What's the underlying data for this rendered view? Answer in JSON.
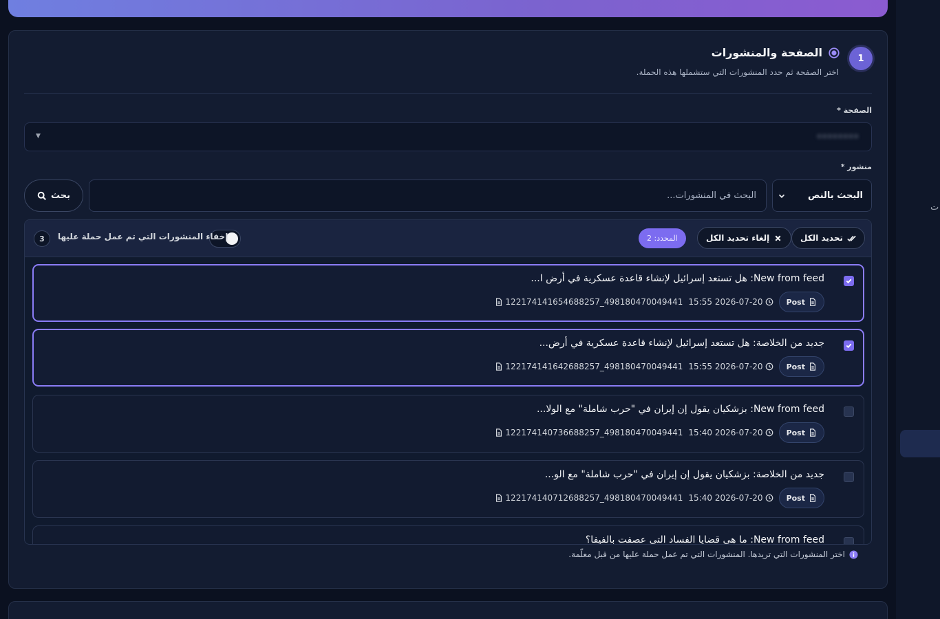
{
  "section": {
    "step_number": "1",
    "title": "الصفحة والمنشورات",
    "subtitle": "اختر الصفحة ثم حدد المنشورات التي ستشملها هذه الحملة."
  },
  "page_field": {
    "label": "الصفحة *",
    "value": "••••••••"
  },
  "post_field": {
    "label": "منشور *"
  },
  "search": {
    "type_label": "البحث بالنص",
    "placeholder": "البحث في المنشورات...",
    "button_label": "بحث"
  },
  "toolbar": {
    "select_all": "تحديد الكل",
    "deselect_all": "إلغاء تحديد الكل",
    "selected_count": "المحدد: 2",
    "hide_label": "إخفاء المنشورات التي تم عمل حملة عليها",
    "hide_toggle_on": true,
    "hidden_count": "3"
  },
  "posts": [
    {
      "title": "New from feed: هل تستعد إسرائيل لإنشاء قاعدة عسكرية في أرض ا...",
      "type": "Post",
      "datetime": "2026-07-20 15:55",
      "id": "498180470049441_122174141654688257",
      "selected": true
    },
    {
      "title": "جديد من الخلاصة: هل تستعد إسرائيل لإنشاء قاعدة عسكرية في أرض...",
      "type": "Post",
      "datetime": "2026-07-20 15:55",
      "id": "498180470049441_122174141642688257",
      "selected": true
    },
    {
      "title": "New from feed: بزشكيان يقول إن إيران في \"حرب شاملة\" مع الولا...",
      "type": "Post",
      "datetime": "2026-07-20 15:40",
      "id": "498180470049441_122174140736688257",
      "selected": false
    },
    {
      "title": "جديد من الخلاصة: بزشكيان يقول إن إيران في \"حرب شاملة\" مع الو...",
      "type": "Post",
      "datetime": "2026-07-20 15:40",
      "id": "498180470049441_122174140712688257",
      "selected": false
    },
    {
      "title": "New from feed: ما هي قضايا الفساد التي عصفت بالفيفا؟",
      "type": "Post",
      "datetime": "",
      "id": "",
      "selected": false
    }
  ],
  "help_text": "اختر المنشورات التي تريدها. المنشورات التي تم عمل حملة عليها من قبل معلّمة.",
  "side_panel_text": "ت",
  "colors": {
    "accent": "#7c6cf0",
    "background": "#0b1120",
    "card": "#131c31"
  }
}
